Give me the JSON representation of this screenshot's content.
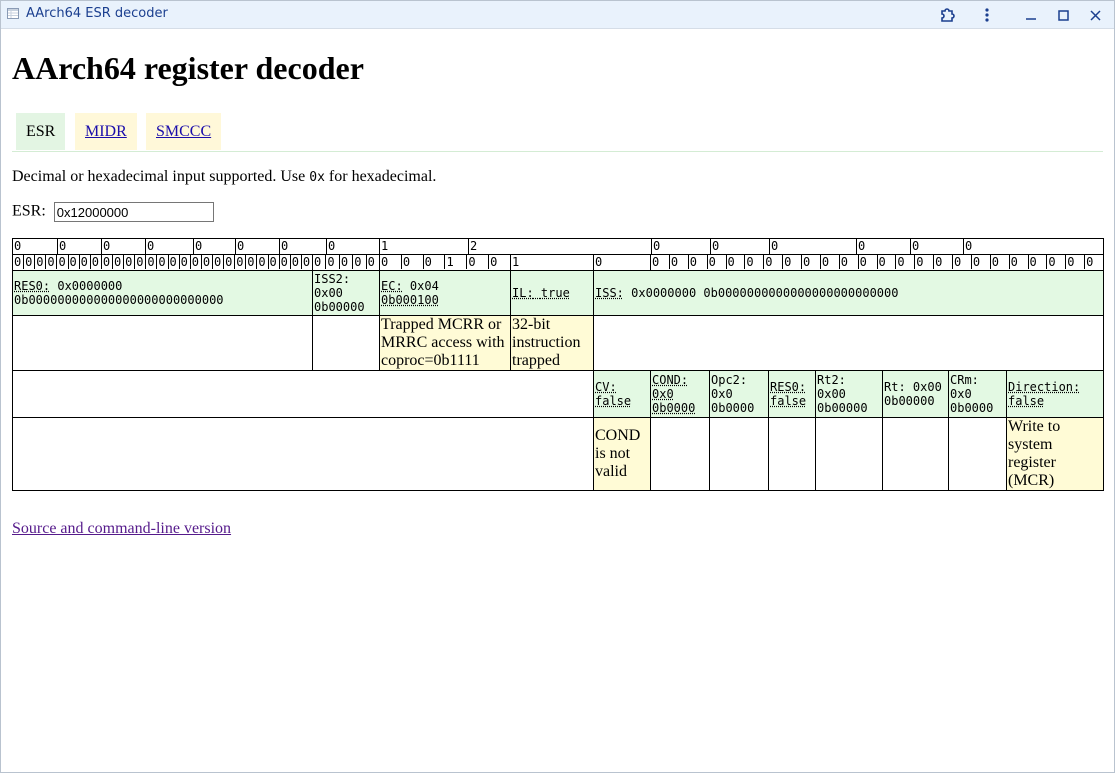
{
  "window": {
    "title": "AArch64 ESR decoder"
  },
  "page": {
    "heading": "AArch64 register decoder",
    "tabs": [
      {
        "label": "ESR",
        "active": true
      },
      {
        "label": "MIDR",
        "active": false
      },
      {
        "label": "SMCCC",
        "active": false
      }
    ],
    "description_before": "Decimal or hexadecimal input supported. Use ",
    "description_code": "0x",
    "description_after": " for hexadecimal.",
    "esr_label": "ESR:",
    "esr_value": "0x12000000",
    "footer_link": "Source and command-line version"
  },
  "decoder": {
    "byte_groups": [
      "0",
      "0",
      "0",
      "0",
      "0",
      "0",
      "0",
      "0",
      "1",
      "2",
      "0",
      "0",
      "0",
      "0",
      "0",
      "0"
    ],
    "bits_res0": [
      "0",
      "0",
      "0",
      "0",
      "0",
      "0",
      "0",
      "0",
      "0",
      "0",
      "0",
      "0",
      "0",
      "0",
      "0",
      "0",
      "0",
      "0",
      "0",
      "0",
      "0",
      "0",
      "0",
      "0",
      "0",
      "0",
      "0"
    ],
    "bits_iss2": [
      "0",
      "0",
      "0",
      "0",
      "0"
    ],
    "bits_ec": [
      "0",
      "0",
      "0",
      "1",
      "0",
      "0"
    ],
    "bit_il": "1",
    "bit_cv": "0",
    "bits_rest": [
      "0",
      "0",
      "0",
      "0",
      "0",
      "0",
      "0",
      "0",
      "0",
      "0",
      "0",
      "0",
      "0",
      "0",
      "0",
      "0",
      "0",
      "0",
      "0",
      "0",
      "0",
      "0",
      "0",
      "0"
    ],
    "fields": {
      "res0": {
        "name": "RES0:",
        "hex": "0x0000000",
        "bin": "0b000000000000000000000000000"
      },
      "iss2": {
        "name": "ISS2:",
        "hex": "0x00",
        "bin": "0b00000"
      },
      "ec": {
        "name": "EC:",
        "hex": "0x04",
        "bin": "0b000100"
      },
      "il": {
        "name": "IL:",
        "value": "true"
      },
      "iss": {
        "name": "ISS:",
        "hex": "0x0000000",
        "bin": "0b0000000000000000000000000"
      }
    },
    "field_notes": {
      "ec": "Trapped MCRR or MRRC access with coproc=0b1111",
      "il": "32-bit instruction trapped"
    },
    "iss_fields": {
      "cv": {
        "name": "CV:",
        "value": "false"
      },
      "cond": {
        "name": "COND:",
        "hex": "0x0",
        "bin": "0b0000"
      },
      "opc2": {
        "name": "Opc2:",
        "hex": "0x0",
        "bin": "0b0000"
      },
      "res0": {
        "name": "RES0:",
        "value": "false"
      },
      "rt2": {
        "name": "Rt2:",
        "hex": "0x00",
        "bin": "0b00000"
      },
      "rt": {
        "name": "Rt:",
        "hex": "0x00",
        "bin": "0b00000"
      },
      "crm": {
        "name": "CRm:",
        "hex": "0x0",
        "bin": "0b0000"
      },
      "direction": {
        "name": "Direction:",
        "value": "false"
      }
    },
    "iss_notes": {
      "cv": "COND is not valid",
      "direction": "Write to system register (MCR)"
    }
  },
  "colors": {
    "field_bg": "#e3f9e3",
    "note_bg": "#fffbd6",
    "active_tab_bg": "#e3f5e3",
    "inactive_tab_bg": "#fff8d9",
    "titlebar_bg": "#e9f2fc"
  }
}
